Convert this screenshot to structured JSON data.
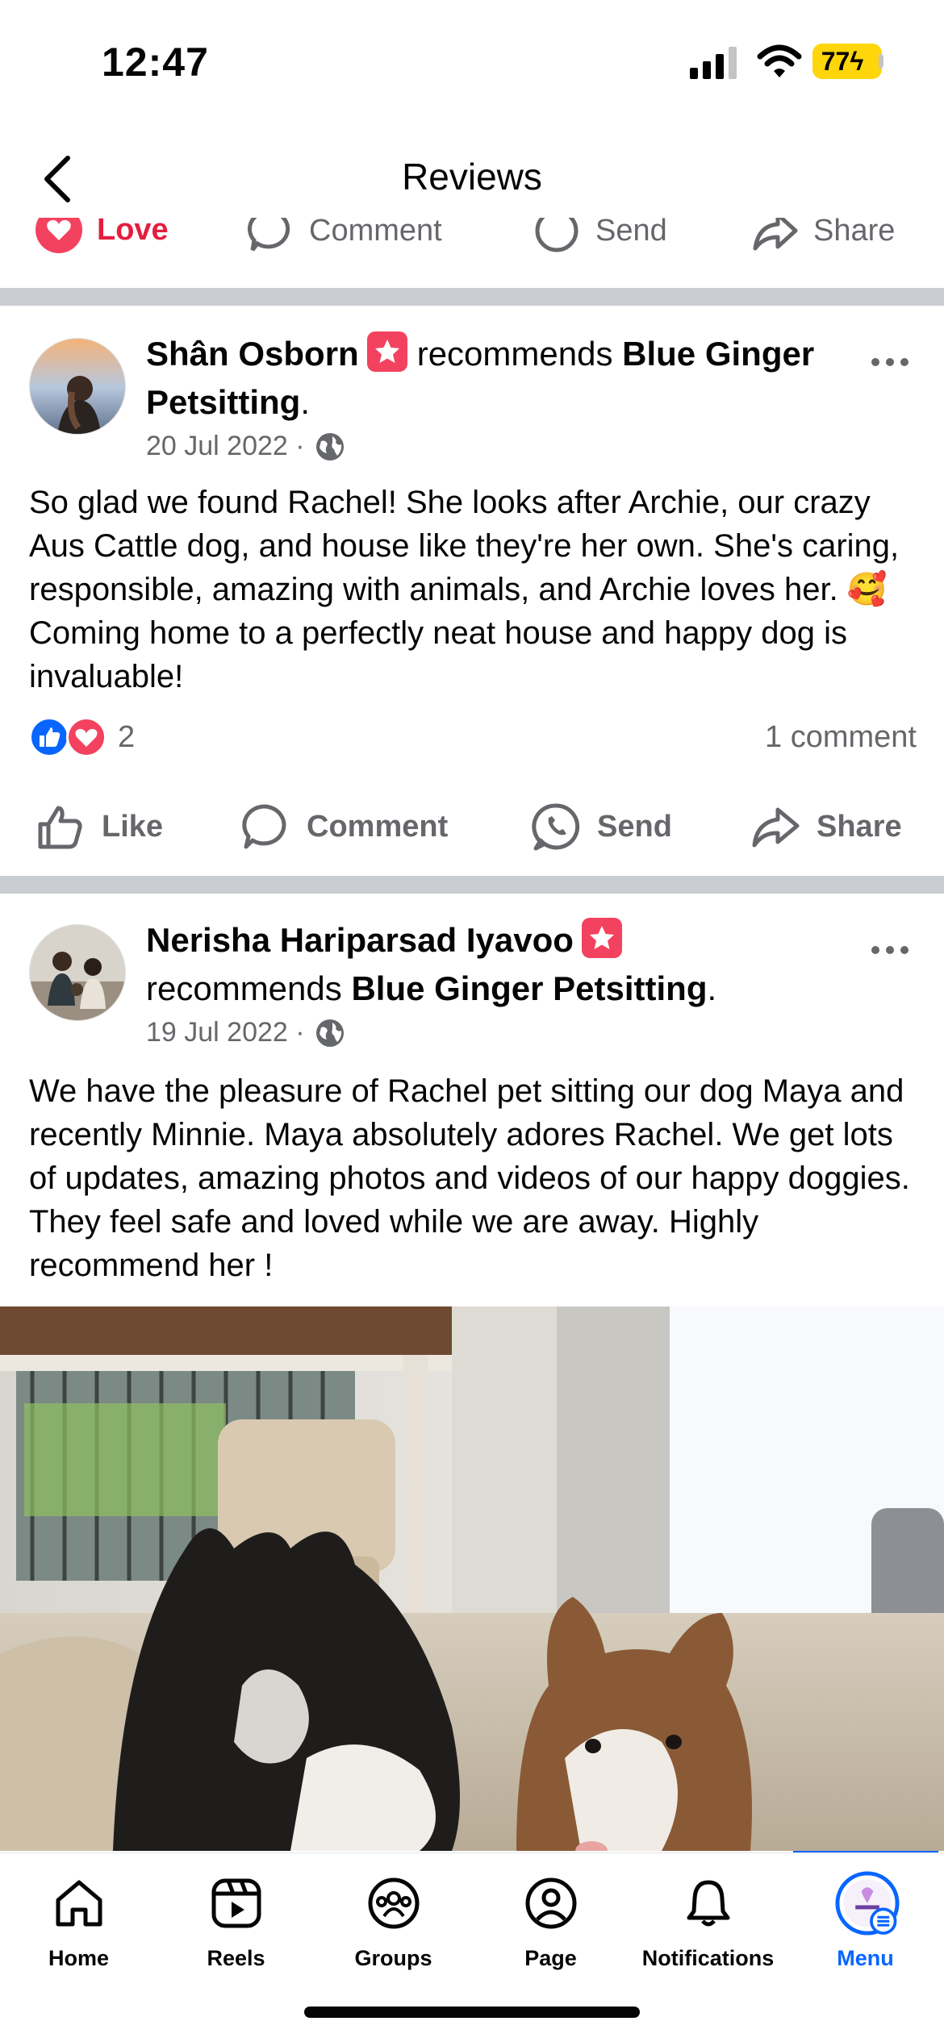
{
  "status": {
    "time": "12:47",
    "battery": "77"
  },
  "nav": {
    "title": "Reviews"
  },
  "partial_actions": {
    "love": "Love",
    "comment": "Comment",
    "send": "Send",
    "share": "Share"
  },
  "posts": [
    {
      "author": "Shân Osborn",
      "recommends": "recommends",
      "page": "Blue Ginger Petsitting",
      "date": "20 Jul 2022 ·",
      "body": "So glad we found Rachel! She looks after Archie, our crazy Aus Cattle dog, and house like they're her own. She's caring, responsible, amazing with animals, and Archie loves her. 🥰 Coming home to a perfectly neat house and happy dog is invaluable!",
      "reaction_count": "2",
      "comment_count": "1 comment"
    },
    {
      "author": "Nerisha Hariparsad Iyavoo",
      "recommends": "recommends",
      "page": "Blue Ginger Petsitting",
      "date": "19 Jul 2022 ·",
      "body": "We have the pleasure of Rachel pet sitting our dog Maya and recently Minnie. Maya absolutely adores Rachel. We get lots of updates, amazing photos and videos of our happy doggies. They feel safe and loved while we are away. Highly recommend her !"
    }
  ],
  "actions": {
    "like": "Like",
    "comment": "Comment",
    "send": "Send",
    "share": "Share"
  },
  "tabs": [
    {
      "label": "Home",
      "icon": "home-icon"
    },
    {
      "label": "Reels",
      "icon": "reels-icon"
    },
    {
      "label": "Groups",
      "icon": "groups-icon"
    },
    {
      "label": "Page",
      "icon": "page-icon"
    },
    {
      "label": "Notifications",
      "icon": "bell-icon"
    },
    {
      "label": "Menu",
      "icon": "menu-avatar-icon",
      "active": true
    }
  ],
  "colors": {
    "accent": "#0866ff",
    "love": "#f3425f",
    "like": "#0866ff",
    "battery": "#ffd60a"
  }
}
